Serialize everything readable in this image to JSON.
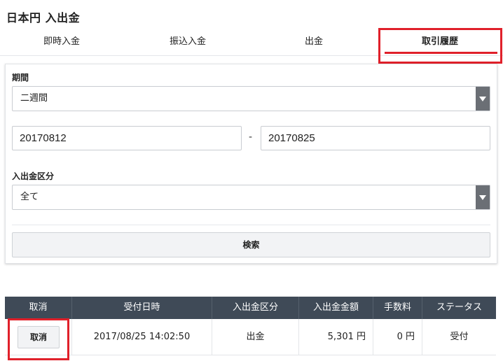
{
  "page": {
    "title": "日本円 入出金"
  },
  "tabs": [
    {
      "label": "即時入金"
    },
    {
      "label": "振込入金"
    },
    {
      "label": "出金"
    },
    {
      "label": "取引履歴",
      "active": true
    }
  ],
  "filter": {
    "period_label": "期間",
    "period_value": "二週間",
    "date_from": "20170812",
    "date_separator": "-",
    "date_to": "20170825",
    "kind_label": "入出金区分",
    "kind_value": "全て",
    "search_label": "検索"
  },
  "table": {
    "headers": [
      "取消",
      "受付日時",
      "入出金区分",
      "入出金金額",
      "手数料",
      "ステータス"
    ],
    "rows": [
      {
        "cancel_label": "取消",
        "datetime": "2017/08/25 14:02:50",
        "kind": "出金",
        "amount": "5,301 円",
        "fee": "0 円",
        "status": "受付"
      }
    ]
  },
  "colors": {
    "accent_red": "#e0202a",
    "table_header": "#3f4a57",
    "select_arrow": "#6b6f75"
  }
}
